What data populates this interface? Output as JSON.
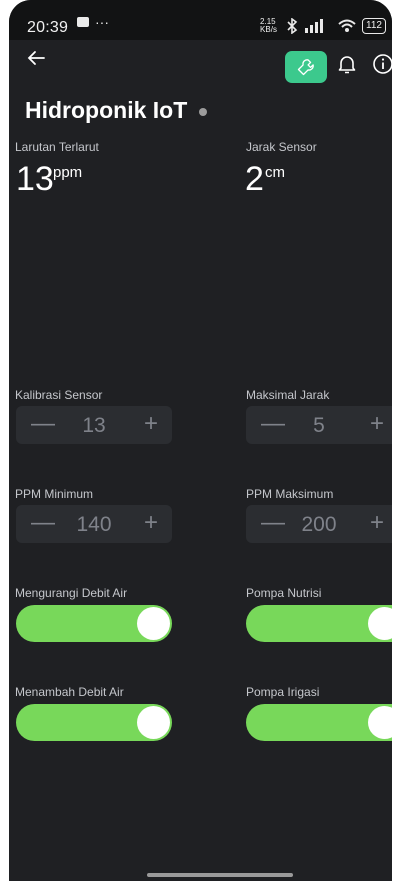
{
  "status_bar": {
    "time": "20:39",
    "left_icons": [
      "screen-record-icon",
      "more-dots-icon"
    ],
    "speed": "2.15 KB/s",
    "battery": "112"
  },
  "header": {
    "title": "Hidroponik IoT",
    "accent_color": "#3cc98d"
  },
  "sensors": [
    {
      "label": "Larutan Terlarut",
      "value": "13",
      "unit": "ppm"
    },
    {
      "label": "Jarak Sensor",
      "value": "2",
      "unit": "cm"
    }
  ],
  "settings": [
    {
      "label": "Kalibrasi Sensor",
      "value": "13",
      "minus": "—",
      "plus": "+"
    },
    {
      "label": "Maksimal Jarak",
      "value": "5",
      "minus": "—",
      "plus": "+"
    },
    {
      "label": "PPM Minimum",
      "value": "140",
      "minus": "—",
      "plus": "+"
    },
    {
      "label": "PPM Maksimum",
      "value": "200",
      "minus": "—",
      "plus": "+"
    }
  ],
  "toggles": [
    {
      "label": "Mengurangi Debit Air",
      "on": true
    },
    {
      "label": "Pompa Nutrisi",
      "on": true
    },
    {
      "label": "Menambah Debit Air",
      "on": true
    },
    {
      "label": "Pompa Irigasi",
      "on": true
    }
  ],
  "colors": {
    "background": "#1f2023",
    "toggle_on": "#78d85a",
    "stepper_bg": "#2b2d31"
  }
}
